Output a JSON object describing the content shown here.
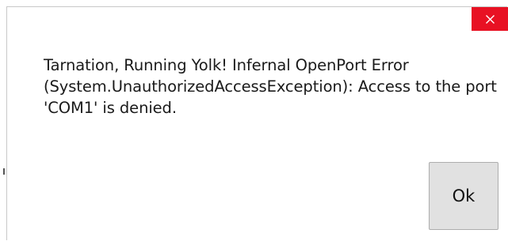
{
  "dialog": {
    "message": "Tarnation, Running Yolk! Infernal OpenPort Error (System.UnauthorizedAccessException): Access to the port 'COM1' is denied.",
    "ok_label": "Ok",
    "close_icon": "close-icon",
    "close_color": "#e81123"
  }
}
